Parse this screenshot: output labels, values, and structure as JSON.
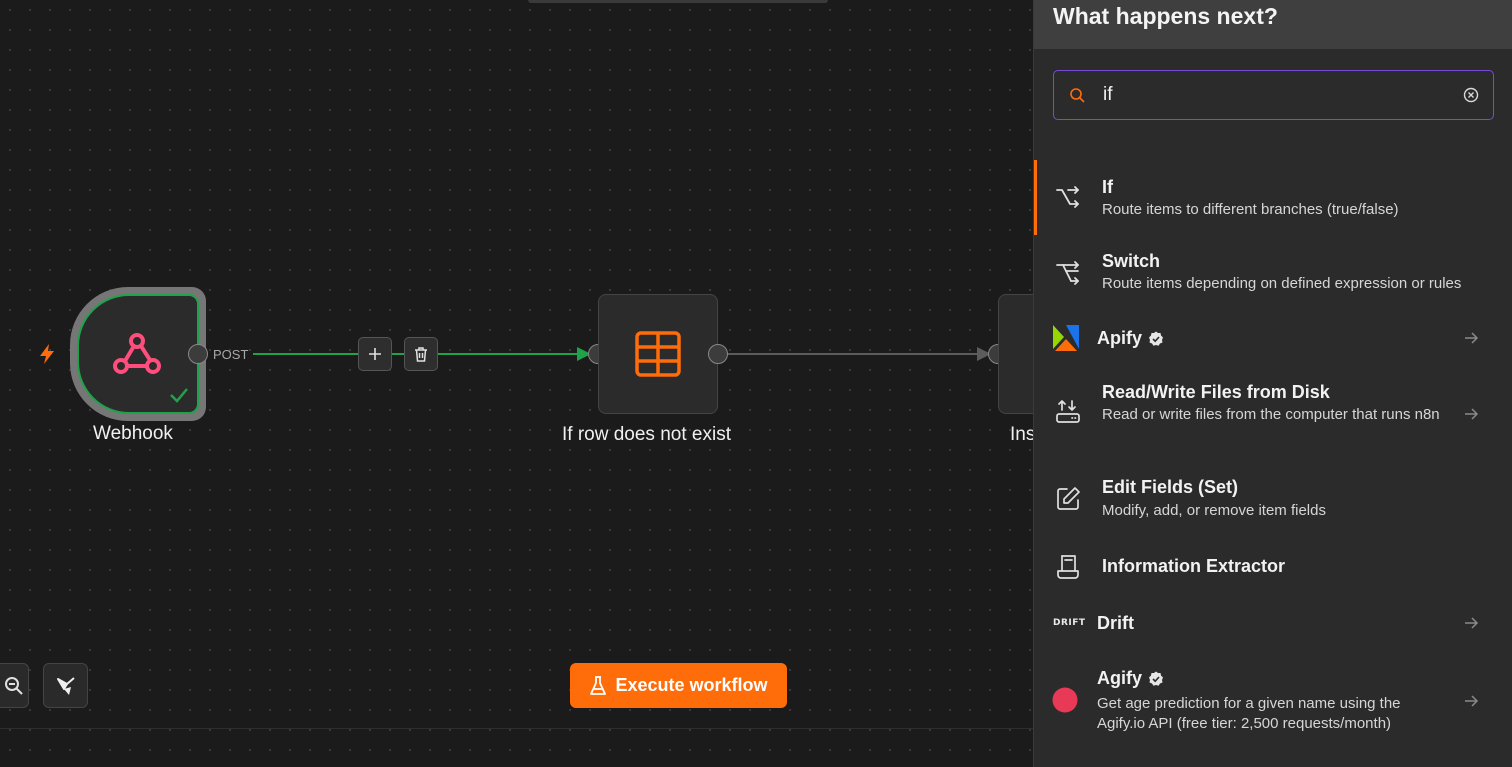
{
  "canvas": {
    "nodes": [
      {
        "label": "Webhook"
      },
      {
        "label": "If row does not exist"
      },
      {
        "label": "Ins"
      }
    ],
    "edge_label": "POST",
    "execute_label": "Execute workflow"
  },
  "panel": {
    "title": "What happens next?",
    "search_value": "if",
    "items": [
      {
        "title": "If",
        "desc": "Route items to different branches (true/false)",
        "icon": "if-branch-icon"
      },
      {
        "title": "Switch",
        "desc": "Route items depending on defined expression or rules",
        "icon": "switch-icon"
      },
      {
        "title": "Apify",
        "desc": "",
        "icon": "apify-logo"
      },
      {
        "title": "Read/Write Files from Disk",
        "desc": "Read or write files from the computer that runs n8n",
        "icon": "file-disk-icon"
      },
      {
        "title": "Edit Fields (Set)",
        "desc": "Modify, add, or remove item fields",
        "icon": "edit-icon"
      },
      {
        "title": "Information Extractor",
        "desc": "",
        "icon": "document-icon"
      },
      {
        "title": "Drift",
        "desc": "",
        "icon": "drift-logo",
        "logo_text": "DRIFT"
      },
      {
        "title": "Agify",
        "desc": "Get age prediction for a given name using the Agify.io API (free tier: 2,500 requests/month)",
        "icon": "agify-logo"
      }
    ]
  },
  "colors": {
    "accent": "#ff6d0a",
    "success": "#1fa34a",
    "search_border": "#7a4bd6",
    "webhook_pink": "#ff4d7d",
    "agify_red": "#e83a57"
  }
}
